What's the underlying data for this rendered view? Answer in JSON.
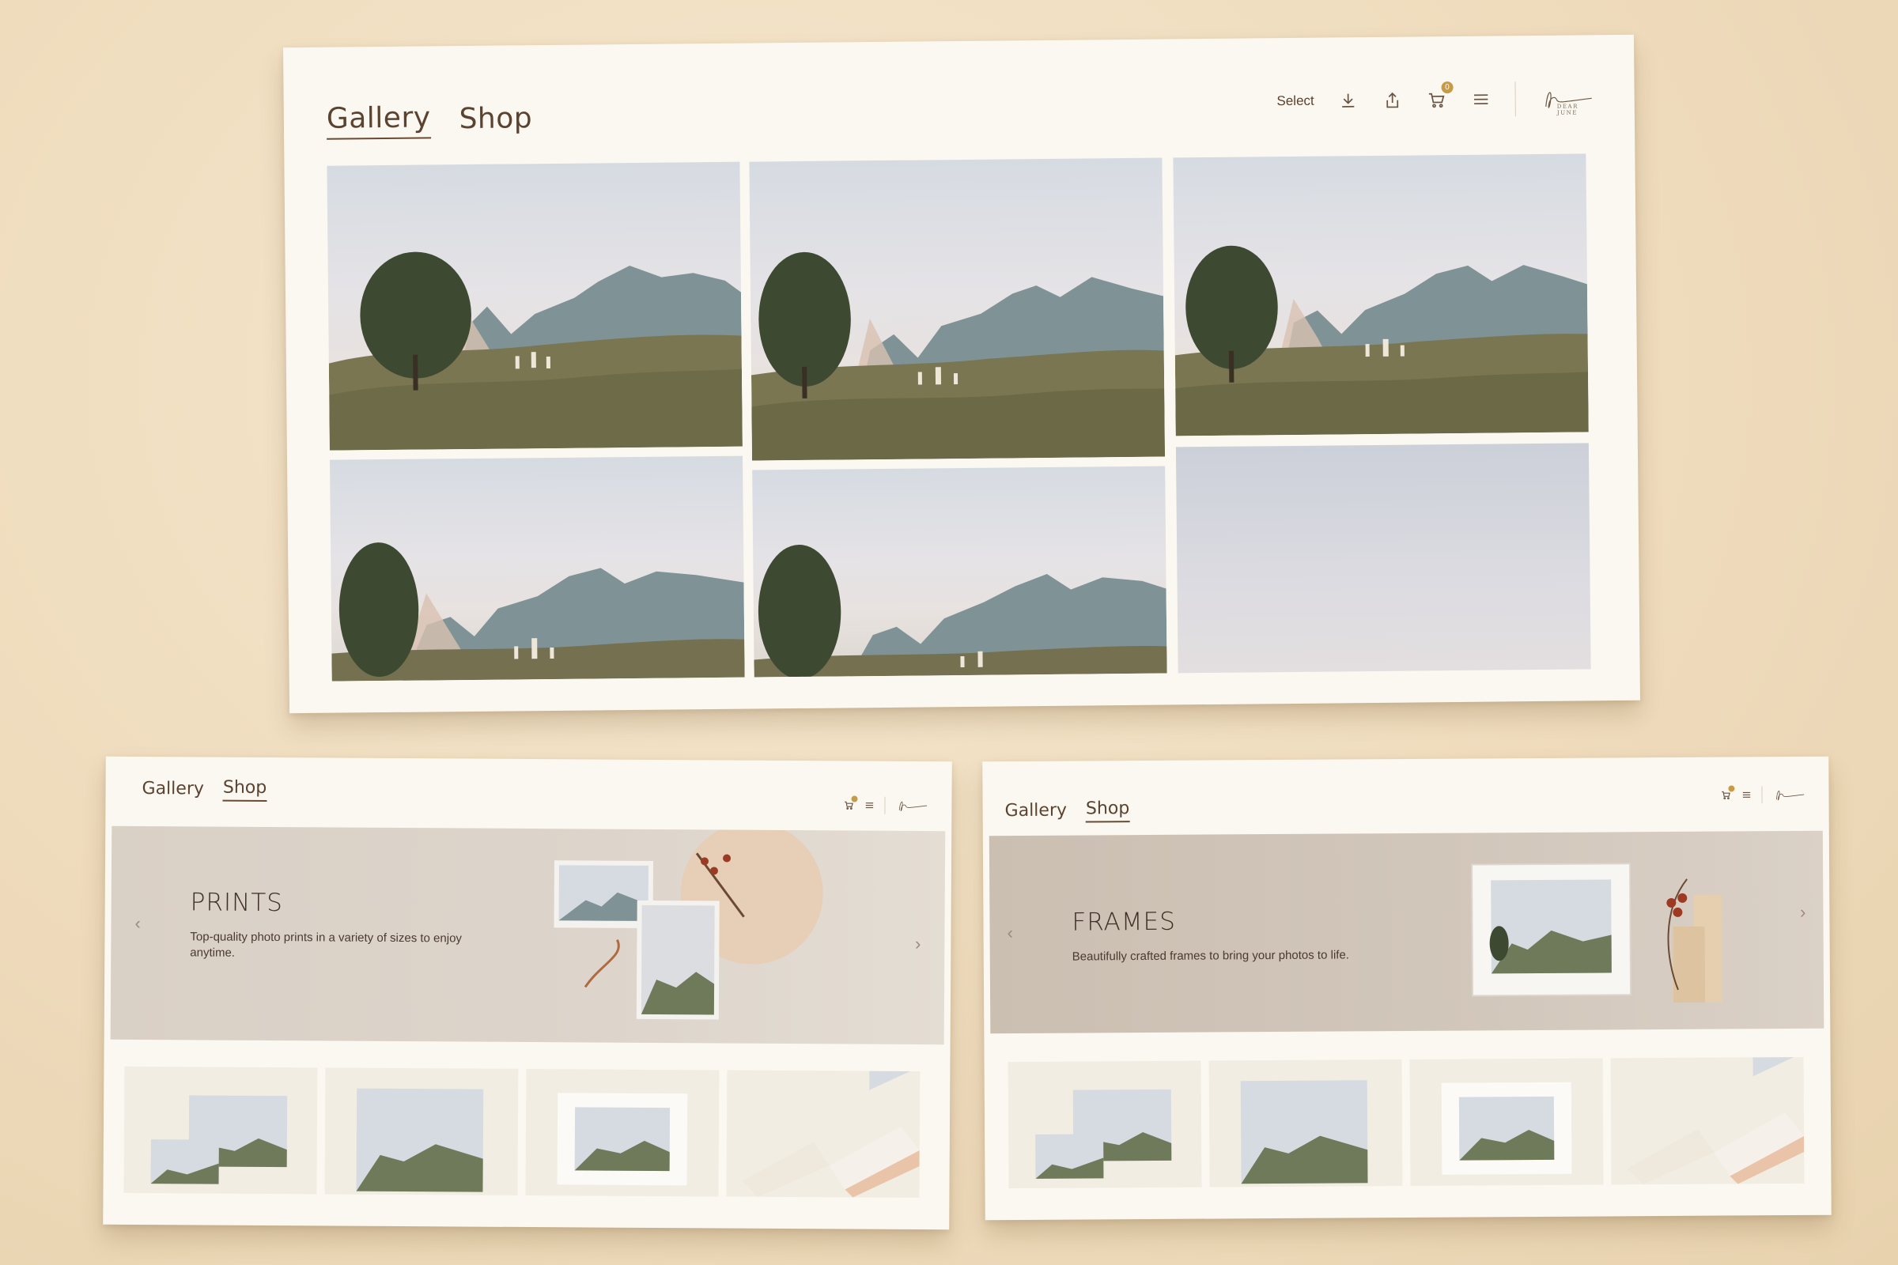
{
  "main": {
    "tabs": [
      {
        "label": "Gallery",
        "active": true
      },
      {
        "label": "Shop",
        "active": false
      }
    ],
    "toolbar": {
      "select_label": "Select",
      "cart_count": "0",
      "icons": [
        "download-icon",
        "share-icon",
        "cart-icon",
        "menu-icon"
      ]
    },
    "logo_text": "DEAR JUNE"
  },
  "prints": {
    "tabs": [
      {
        "label": "Gallery",
        "active": false
      },
      {
        "label": "Shop",
        "active": true
      }
    ],
    "hero": {
      "title": "PRINTS",
      "description_line1": "Top-quality photo prints in a variety of sizes to enjoy",
      "description_line2": "anytime."
    },
    "logo_text": "DEAR JUNE"
  },
  "frames": {
    "tabs": [
      {
        "label": "Gallery",
        "active": false
      },
      {
        "label": "Shop",
        "active": true
      }
    ],
    "hero": {
      "title": "FRAMES",
      "description": "Beautifully crafted frames to bring your photos to life."
    },
    "logo_text": "DEAR JUNE"
  },
  "colors": {
    "background": "#efdcbd",
    "card": "#fbf8f1",
    "prints_hero": "#dcd3c8",
    "frames_hero": "#cfc3b6",
    "accent": "#c79a45",
    "text": "#5b4330"
  }
}
